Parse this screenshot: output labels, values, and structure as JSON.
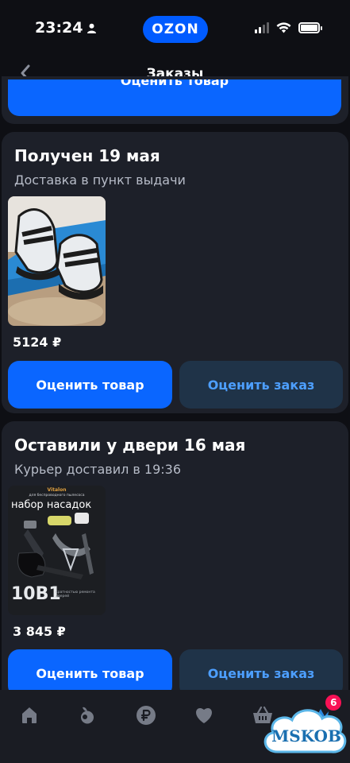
{
  "status_bar": {
    "time": "23:24",
    "logo": "OZON"
  },
  "nav": {
    "title": "Заказы",
    "back_icon": "chevron-left-icon"
  },
  "top_card": {
    "rate_label": "Оценить товар"
  },
  "orders": [
    {
      "title": "Получен 19 мая",
      "subtitle": "Доставка в пункт выдачи",
      "price": "5124 ₽",
      "rate_label": "Оценить товар",
      "rate_order_label": "Оценить заказ"
    },
    {
      "title": "Оставили у двери 16 мая",
      "subtitle": "Курьер доставил в 19:36",
      "price": "3 845 ₽",
      "rate_label": "Оценить товар",
      "rate_order_label": "Оценить заказ",
      "image_text": {
        "brand": "Vitalon",
        "caption_top": "для беспроводного пылесоса",
        "heading": "набор насадок",
        "big": "10В1",
        "caption_bottom": "кратностью ремонта дверей"
      }
    }
  ],
  "tab_bar": {
    "items": [
      "home-icon",
      "fresh-icon",
      "ruble-icon",
      "heart-icon",
      "cart-icon"
    ],
    "cart_badge": "6"
  },
  "watermark": "MSKOB",
  "colors": {
    "accent": "#0a66ff",
    "secondary_btn": "#1f3348",
    "badge": "#f91155",
    "card": "#1d2029",
    "background": "#0e0f14"
  }
}
